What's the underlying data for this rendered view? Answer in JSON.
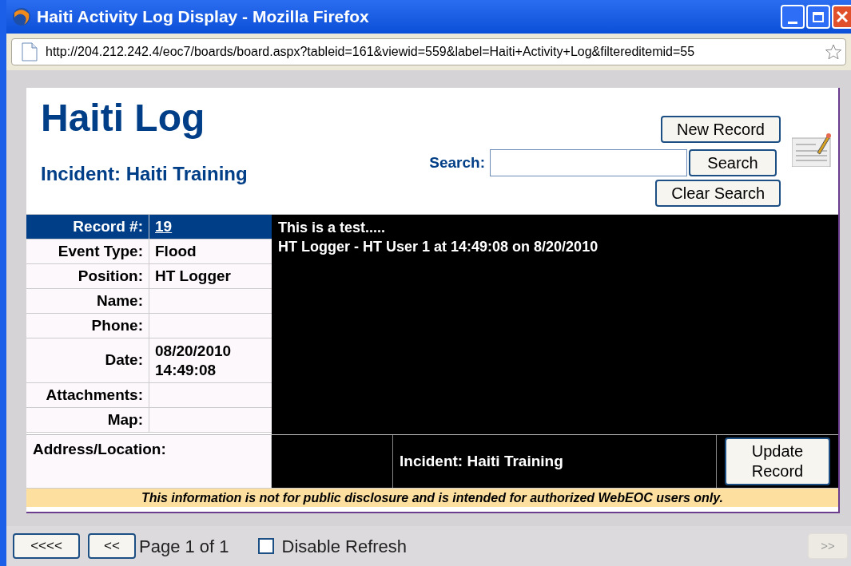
{
  "window": {
    "title": "Haiti Activity Log Display - Mozilla Firefox"
  },
  "address_bar": {
    "url": "http://204.212.242.4/eoc7/boards/board.aspx?tableid=161&viewid=559&label=Haiti+Activity+Log&filtereditemid=55"
  },
  "header": {
    "title": "Haiti Log",
    "incident": "Incident: Haiti Training",
    "new_record_button": "New Record",
    "search_label": "Search:",
    "search_button": "Search",
    "clear_button": "Clear Search"
  },
  "fields": [
    {
      "kind": "header",
      "label": "Record #:",
      "value": "19"
    },
    {
      "kind": "field",
      "label": "Event Type:",
      "value": "Flood"
    },
    {
      "kind": "field",
      "label": "Position:",
      "value": "HT Logger"
    },
    {
      "kind": "field",
      "label": "Name:"
    },
    {
      "kind": "field",
      "label": "Phone:"
    },
    {
      "kind": "field",
      "label": "Date:",
      "value": "08/20/2010 14:49:08"
    },
    {
      "kind": "field",
      "label": "Attachments:"
    },
    {
      "kind": "field",
      "label": "Map:"
    }
  ],
  "notes": [
    "This is a test.....",
    "HT Logger - HT User 1 at 14:49:08 on 8/20/2010"
  ],
  "address_label": "Address/Location:",
  "footer_incident": "Incident: Haiti Training",
  "update_button": "Update Record",
  "disclaimer": "This information is not for public disclosure and is intended for authorized WebEOC users only.",
  "pager": {
    "first_button": "<<<<",
    "prev_button": "<<",
    "page_text": "Page 1 of 1",
    "disable_refresh": {
      "label": "Disable Refresh",
      "checked": false
    },
    "next_button": {
      "label": ">>",
      "disabled": true
    }
  }
}
